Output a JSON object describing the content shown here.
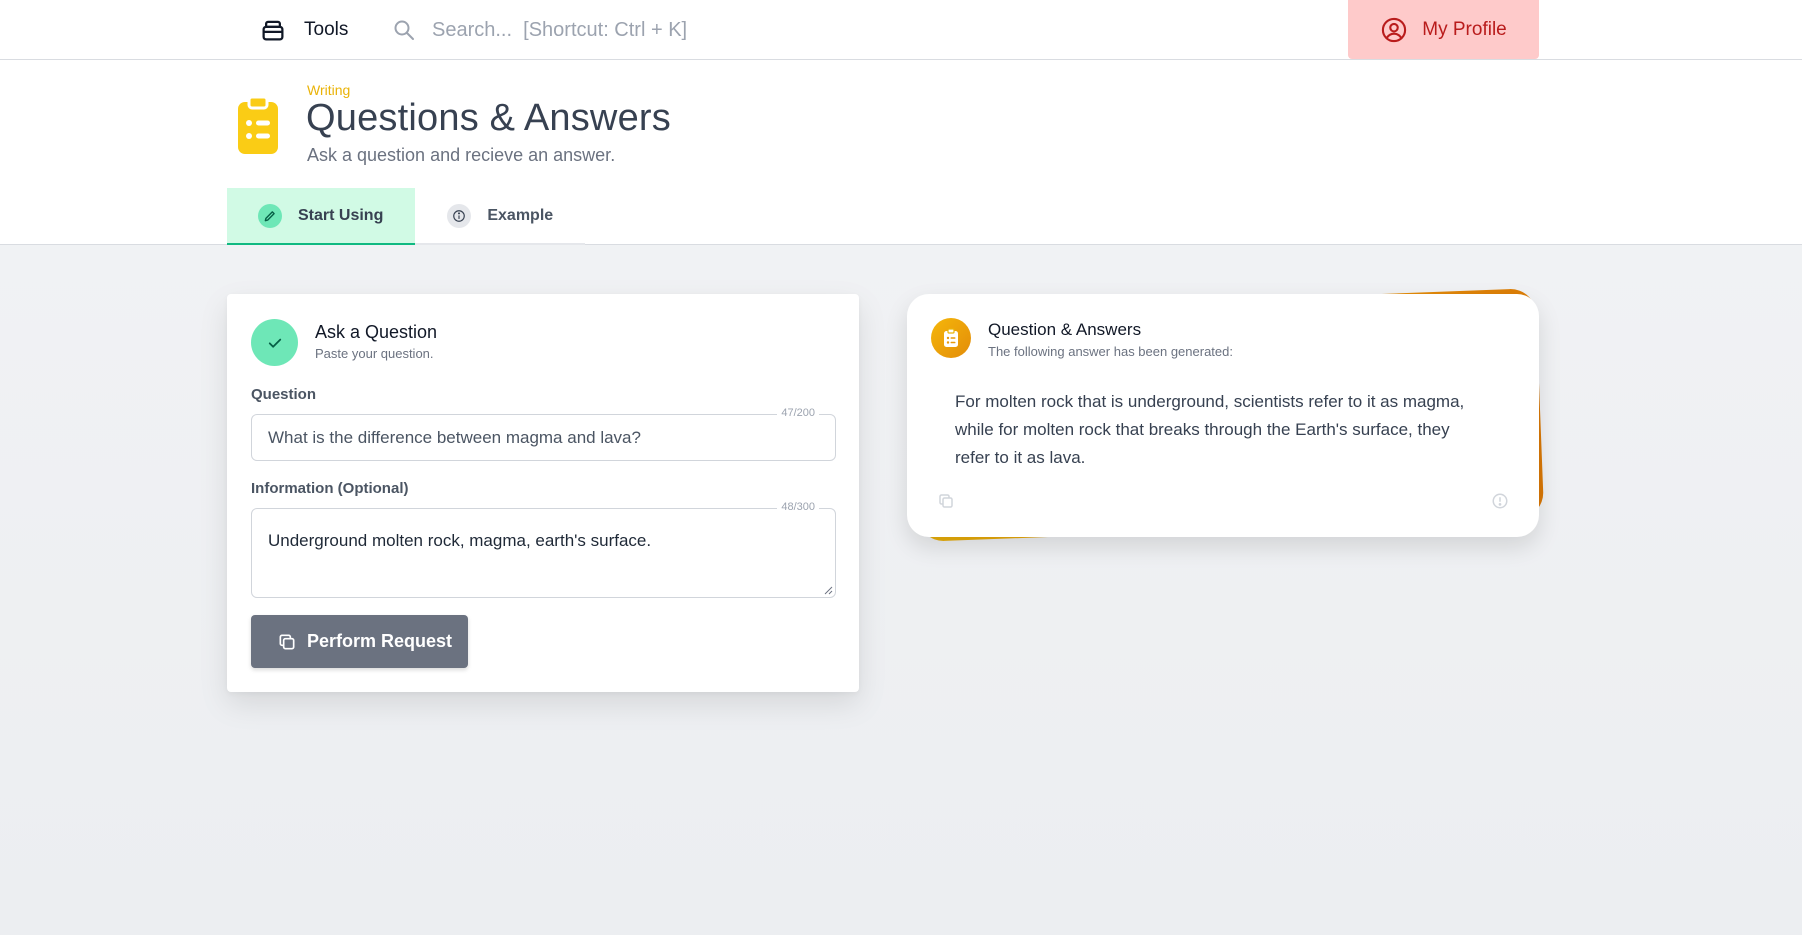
{
  "topbar": {
    "tools_label": "Tools",
    "search_placeholder": "Search...  [Shortcut: Ctrl + K]",
    "profile_label": "My Profile"
  },
  "header": {
    "category": "Writing",
    "title": "Questions & Answers",
    "subtitle": "Ask a question and recieve an answer.",
    "tabs": [
      {
        "label": "Start Using",
        "icon": "pencil-icon",
        "active": true
      },
      {
        "label": "Example",
        "icon": "info-icon",
        "active": false
      }
    ]
  },
  "form": {
    "title": "Ask a Question",
    "subtitle": "Paste your question.",
    "question_label": "Question",
    "question_counter": "47/200",
    "question_value": "What is the difference between magma and lava?",
    "info_label": "Information (Optional)",
    "info_counter": "48/300",
    "info_value": "Underground molten rock, magma, earth's surface.",
    "submit_label": "Perform Request"
  },
  "answer": {
    "title": "Question & Answers",
    "subtitle": "The following answer has been generated:",
    "text": "For molten rock that is underground, scientists refer to it as magma, while for molten rock that breaks through the Earth's surface, they refer to it as lava."
  },
  "colors": {
    "accent_green": "#6ee7b7",
    "accent_yellow": "#eab308",
    "profile_bg": "#fecaca",
    "profile_text": "#b91c1c",
    "button_gray": "#6b7280"
  }
}
